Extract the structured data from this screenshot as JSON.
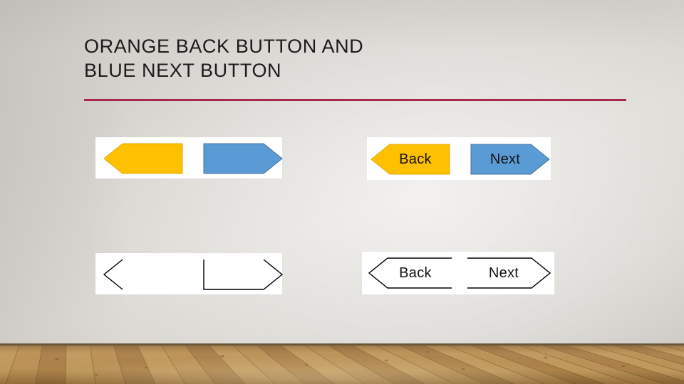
{
  "slide": {
    "title_line_1": "ORANGE BACK BUTTON AND",
    "title_line_2": "BLUE NEXT BUTTON",
    "accent_rule_color": "#a8284a",
    "background_wall_color": "#d6d3ce",
    "floor_color": "#b08345"
  },
  "colors": {
    "orange_fill": "#ffc000",
    "orange_stroke": "#e0a800",
    "blue_fill": "#5b9bd5",
    "blue_stroke": "#41729f",
    "outline_stroke": "#000000",
    "label_text": "#141414",
    "panel_background": "#ffffff"
  },
  "groups": [
    {
      "id": "filled-unlabeled",
      "name": "Filled arrows without labels",
      "back": {
        "label": "",
        "direction": "left",
        "style": "filled",
        "fill": "#ffc000"
      },
      "next": {
        "label": "",
        "direction": "right",
        "style": "filled",
        "fill": "#5b9bd5"
      }
    },
    {
      "id": "filled-labeled",
      "name": "Filled arrows with labels",
      "back": {
        "label": "Back",
        "direction": "left",
        "style": "filled",
        "fill": "#ffc000"
      },
      "next": {
        "label": "Next",
        "direction": "right",
        "style": "filled",
        "fill": "#5b9bd5"
      }
    },
    {
      "id": "outline-unlabeled",
      "name": "Outline arrows without labels",
      "back": {
        "label": "",
        "direction": "left",
        "style": "outline",
        "fill": "none"
      },
      "next": {
        "label": "",
        "direction": "right",
        "style": "outline",
        "fill": "none"
      }
    },
    {
      "id": "outline-labeled",
      "name": "Outline arrows with labels",
      "back": {
        "label": "Back",
        "direction": "left",
        "style": "outline",
        "fill": "none"
      },
      "next": {
        "label": "Next",
        "direction": "right",
        "style": "outline",
        "fill": "none"
      }
    }
  ]
}
